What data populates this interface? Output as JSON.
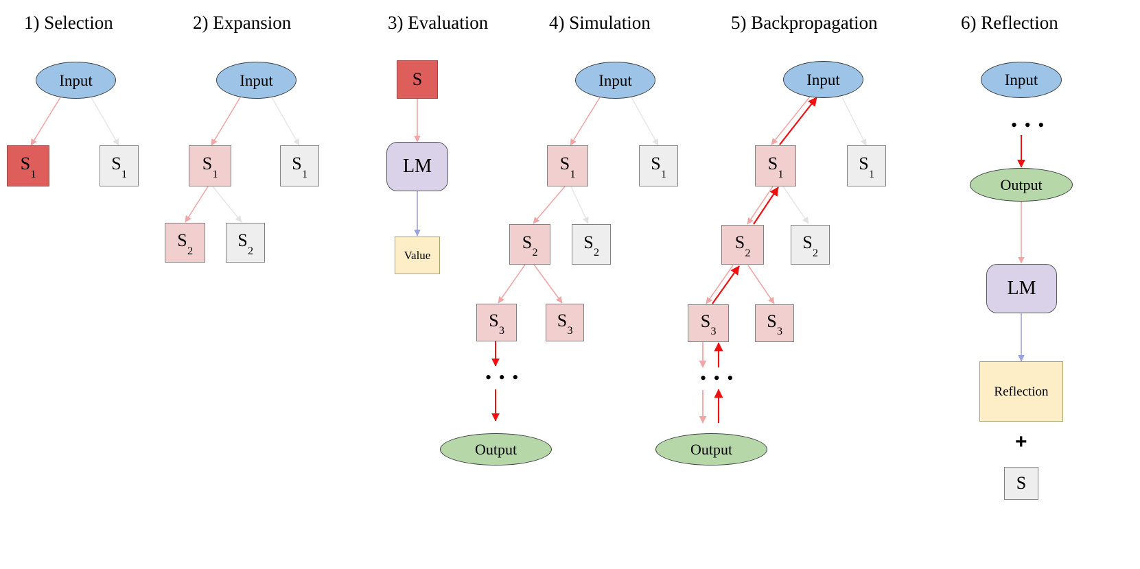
{
  "figure": {
    "type": "diagram",
    "description": "Six-stage language-agent tree-search loop diagram",
    "background": "#ffffff"
  },
  "colors": {
    "node_blue": "#9dc3e6",
    "node_green": "#b6d7a8",
    "node_red_selected": "#dd5e5a",
    "node_pink": "#f2cfcf",
    "node_gray": "#eeeeee",
    "node_lavender": "#d9d2e9",
    "node_cream": "#fdeec8",
    "edge_pink": "#f1a6a6",
    "edge_gray": "#e8e8e8",
    "edge_red": "#ee1111",
    "edge_blue": "#9aa3dd",
    "border_gray": "#808080",
    "border_dark": "#3c4043"
  },
  "panels": [
    {
      "id": "selection",
      "title": "1) Selection",
      "nodes": [
        {
          "name": "input",
          "label": "Input",
          "shape": "ellipse",
          "fill": "node_blue"
        },
        {
          "name": "s1-selected",
          "label": "S",
          "sub": "1",
          "shape": "box",
          "fill": "node_red_selected"
        },
        {
          "name": "s1-alt",
          "label": "S",
          "sub": "1",
          "shape": "box",
          "fill": "node_gray"
        }
      ]
    },
    {
      "id": "expansion",
      "title": "2) Expansion",
      "nodes": [
        {
          "name": "input",
          "label": "Input",
          "shape": "ellipse",
          "fill": "node_blue"
        },
        {
          "name": "s1-active",
          "label": "S",
          "sub": "1",
          "shape": "box",
          "fill": "node_pink"
        },
        {
          "name": "s1-alt",
          "label": "S",
          "sub": "1",
          "shape": "box",
          "fill": "node_gray"
        },
        {
          "name": "s2-active",
          "label": "S",
          "sub": "2",
          "shape": "box",
          "fill": "node_pink"
        },
        {
          "name": "s2-alt",
          "label": "S",
          "sub": "2",
          "shape": "box",
          "fill": "node_gray"
        }
      ]
    },
    {
      "id": "evaluation",
      "title": "3) Evaluation",
      "nodes": [
        {
          "name": "state-s",
          "label": "S",
          "shape": "box",
          "fill": "node_red_selected"
        },
        {
          "name": "language-model",
          "label": "LM",
          "shape": "rounded",
          "fill": "node_lavender"
        },
        {
          "name": "value",
          "label": "Value",
          "shape": "box",
          "fill": "node_cream"
        }
      ]
    },
    {
      "id": "simulation",
      "title": "4) Simulation",
      "nodes": [
        {
          "name": "input",
          "label": "Input",
          "shape": "ellipse",
          "fill": "node_blue"
        },
        {
          "name": "s1-active",
          "label": "S",
          "sub": "1",
          "shape": "box",
          "fill": "node_pink"
        },
        {
          "name": "s1-alt",
          "label": "S",
          "sub": "1",
          "shape": "box",
          "fill": "node_gray"
        },
        {
          "name": "s2-active",
          "label": "S",
          "sub": "2",
          "shape": "box",
          "fill": "node_pink"
        },
        {
          "name": "s2-alt",
          "label": "S",
          "sub": "2",
          "shape": "box",
          "fill": "node_gray"
        },
        {
          "name": "s3-left",
          "label": "S",
          "sub": "3",
          "shape": "box",
          "fill": "node_pink"
        },
        {
          "name": "s3-right",
          "label": "S",
          "sub": "3",
          "shape": "box",
          "fill": "node_pink"
        },
        {
          "name": "ellipsis",
          "label": "• • •",
          "shape": "text"
        },
        {
          "name": "output",
          "label": "Output",
          "shape": "ellipse",
          "fill": "node_green"
        }
      ]
    },
    {
      "id": "backpropagation",
      "title": "5) Backpropagation",
      "nodes": [
        {
          "name": "input",
          "label": "Input",
          "shape": "ellipse",
          "fill": "node_blue"
        },
        {
          "name": "s1-active",
          "label": "S",
          "sub": "1",
          "shape": "box",
          "fill": "node_pink"
        },
        {
          "name": "s1-alt",
          "label": "S",
          "sub": "1",
          "shape": "box",
          "fill": "node_gray"
        },
        {
          "name": "s2-active",
          "label": "S",
          "sub": "2",
          "shape": "box",
          "fill": "node_pink"
        },
        {
          "name": "s2-alt",
          "label": "S",
          "sub": "2",
          "shape": "box",
          "fill": "node_gray"
        },
        {
          "name": "s3-left",
          "label": "S",
          "sub": "3",
          "shape": "box",
          "fill": "node_pink"
        },
        {
          "name": "s3-right",
          "label": "S",
          "sub": "3",
          "shape": "box",
          "fill": "node_pink"
        },
        {
          "name": "ellipsis",
          "label": "• • •",
          "shape": "text"
        },
        {
          "name": "output",
          "label": "Output",
          "shape": "ellipse",
          "fill": "node_green"
        }
      ]
    },
    {
      "id": "reflection",
      "title": "6) Reflection",
      "nodes": [
        {
          "name": "input",
          "label": "Input",
          "shape": "ellipse",
          "fill": "node_blue"
        },
        {
          "name": "ellipsis",
          "label": "• • •",
          "shape": "text"
        },
        {
          "name": "output",
          "label": "Output",
          "shape": "ellipse",
          "fill": "node_green"
        },
        {
          "name": "language-model",
          "label": "LM",
          "shape": "rounded",
          "fill": "node_lavender"
        },
        {
          "name": "reflection-text",
          "label": "Reflection",
          "shape": "box",
          "fill": "node_cream"
        },
        {
          "name": "plus",
          "label": "+",
          "shape": "text"
        },
        {
          "name": "state-s",
          "label": "S",
          "shape": "box",
          "fill": "node_gray"
        }
      ]
    }
  ],
  "labels": {
    "input": "Input",
    "output": "Output",
    "lm": "LM",
    "value": "Value",
    "reflection": "Reflection",
    "s": "S",
    "s1_sub": "1",
    "s2_sub": "2",
    "s3_sub": "3",
    "plus": "+",
    "ellipsis": "• • •"
  },
  "titles": {
    "p1": "1) Selection",
    "p2": "2) Expansion",
    "p3": "3) Evaluation",
    "p4": "4) Simulation",
    "p5": "5) Backpropagation",
    "p6": "6) Reflection"
  }
}
